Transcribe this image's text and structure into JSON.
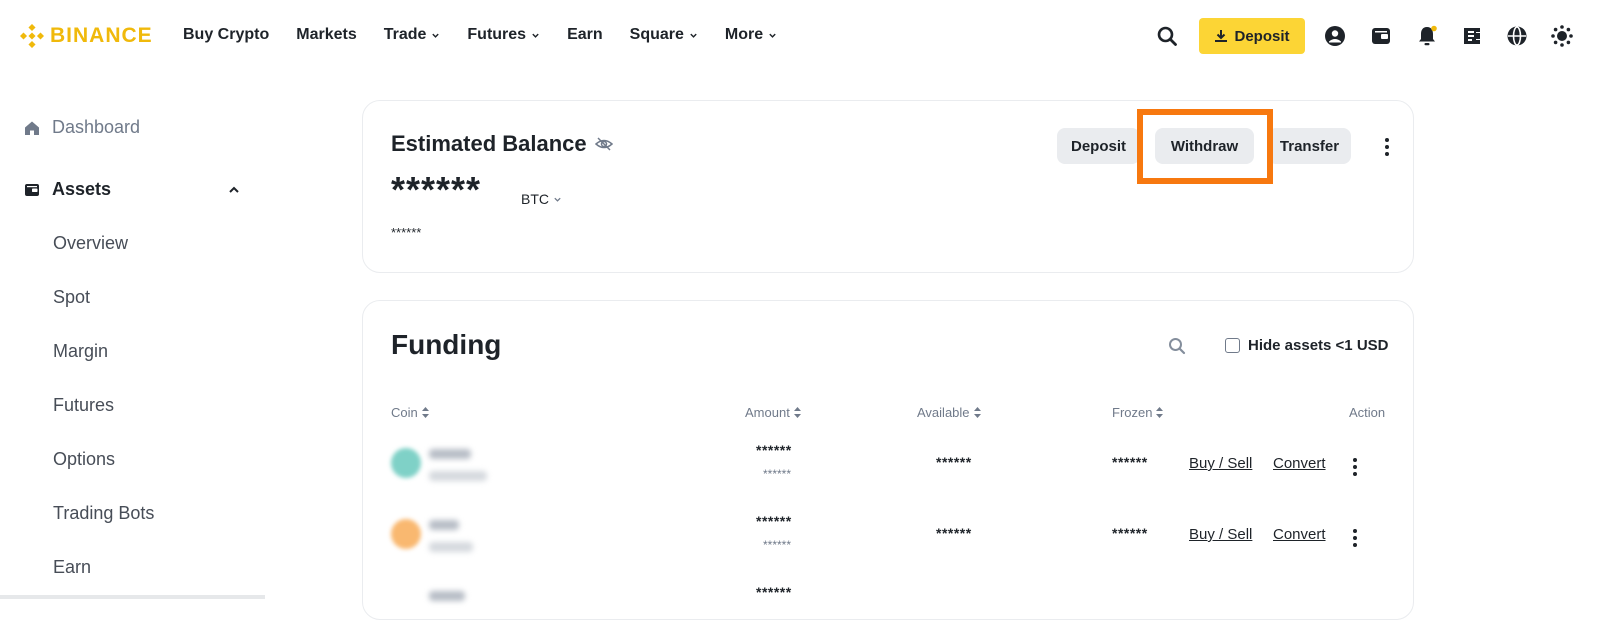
{
  "brand": {
    "name": "BINANCE",
    "color": "#f0b90b"
  },
  "nav": [
    {
      "label": "Buy Crypto",
      "dropdown": false
    },
    {
      "label": "Markets",
      "dropdown": false
    },
    {
      "label": "Trade",
      "dropdown": true
    },
    {
      "label": "Futures",
      "dropdown": true
    },
    {
      "label": "Earn",
      "dropdown": false
    },
    {
      "label": "Square",
      "dropdown": true
    },
    {
      "label": "More",
      "dropdown": true
    }
  ],
  "header": {
    "deposit_label": "Deposit",
    "icons": [
      "search-icon",
      "user-icon",
      "wallet-icon",
      "bell-icon",
      "orders-icon",
      "globe-icon",
      "theme-icon"
    ]
  },
  "sidebar": {
    "dashboard": "Dashboard",
    "assets": "Assets",
    "items": [
      "Overview",
      "Spot",
      "Margin",
      "Futures",
      "Options",
      "Trading Bots",
      "Earn"
    ]
  },
  "balance": {
    "title": "Estimated Balance",
    "value": "******",
    "unit": "BTC",
    "sub_value": "******",
    "buttons": {
      "deposit": "Deposit",
      "withdraw": "Withdraw",
      "transfer": "Transfer"
    },
    "highlight_color": "#f7780f"
  },
  "funding": {
    "title": "Funding",
    "hide_small": "Hide assets <1 USD",
    "columns": {
      "coin": "Coin",
      "amount": "Amount",
      "available": "Available",
      "frozen": "Frozen",
      "action": "Action"
    },
    "rows": [
      {
        "coin_color": "#7fd1c7",
        "amount": "******",
        "amount_sub": "******",
        "available": "******",
        "frozen": "******",
        "buy_sell": "Buy / Sell",
        "convert": "Convert"
      },
      {
        "coin_color": "#f9b870",
        "amount": "******",
        "amount_sub": "******",
        "available": "******",
        "frozen": "******",
        "buy_sell": "Buy / Sell",
        "convert": "Convert"
      }
    ],
    "partial_row_amount": "******"
  }
}
